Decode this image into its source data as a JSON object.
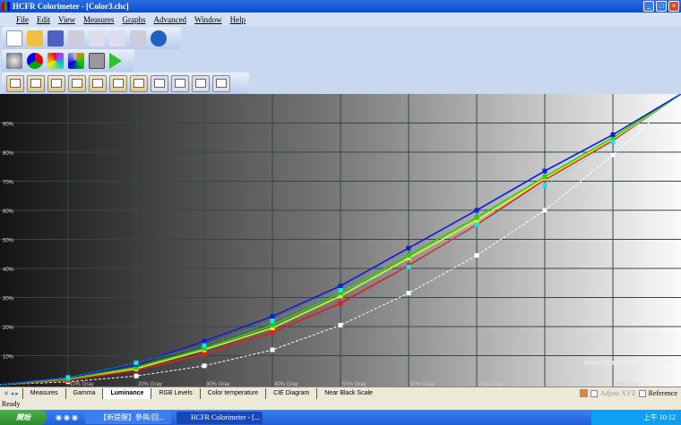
{
  "window": {
    "title": "HCFR Colorimeter - [Color3.chc]"
  },
  "menu": [
    "File",
    "Edit",
    "View",
    "Measures",
    "Graphs",
    "Advanced",
    "Window",
    "Help"
  ],
  "toolbar1": [
    "new-icon",
    "open-icon",
    "save-icon",
    "cut-icon",
    "copy-icon",
    "paste-icon",
    "print-icon",
    "help-icon"
  ],
  "toolbar2": [
    "gray-measure-icon",
    "rgb-measure-icon",
    "saturation-measure-icon",
    "all-colors-icon",
    "camera-icon",
    "play-icon"
  ],
  "toolbar3_count": 11,
  "tabs": [
    "Measures",
    "Gamma",
    "Luminance",
    "RGB Levels",
    "Color temperature",
    "CIE Diagram",
    "Near Black Scale"
  ],
  "active_tab": "Luminance",
  "options": {
    "adjust_label": "Adjust XYZ",
    "reference_label": "Reference"
  },
  "status": "Ready",
  "watermark": "www.homecinema-fr.com",
  "taskbar": {
    "start": "開始",
    "tasks": [
      "【新提醒】參與/回...",
      "HCFR Colorimeter - [..."
    ],
    "clock": "上午 10:12"
  },
  "chart_data": {
    "type": "line",
    "x": [
      0,
      10,
      20,
      30,
      40,
      50,
      60,
      70,
      80,
      90,
      100
    ],
    "x_tick_labels": [
      "",
      "10% Gray",
      "20% Gray",
      "30% Gray",
      "40% Gray",
      "50% Gray",
      "60% Gray",
      "70% Gray",
      "80% Gray",
      "90% Gray",
      ""
    ],
    "y_tick_labels": [
      "10%",
      "20%",
      "30%",
      "40%",
      "50%",
      "60%",
      "70%",
      "80%",
      "90%"
    ],
    "ylim": [
      0,
      100
    ],
    "grid": true,
    "series": [
      {
        "color": "#ffffff",
        "dashed": true,
        "values": [
          0,
          1,
          3,
          6.5,
          12,
          20.5,
          31.5,
          44.5,
          60,
          79,
          100
        ]
      },
      {
        "color": "#e02020",
        "values": [
          0,
          1.5,
          5,
          10.5,
          18,
          28,
          41,
          55,
          70.5,
          84,
          100
        ]
      },
      {
        "color": "#e8f020",
        "values": [
          0,
          2,
          5.5,
          12,
          19.5,
          30.5,
          43.5,
          56.5,
          71,
          84.5,
          100
        ]
      },
      {
        "color": "#20d020",
        "values": [
          0,
          2,
          6,
          12.5,
          20.5,
          31.5,
          44.5,
          57.5,
          71.5,
          85,
          100
        ]
      },
      {
        "color": "#1020d0",
        "values": [
          0,
          2.5,
          7,
          15,
          23.5,
          34,
          47,
          60,
          73.5,
          86,
          100
        ]
      },
      {
        "color": "#20e0e8",
        "dotted": true,
        "values": [
          0,
          2.5,
          7.5,
          13.5,
          22,
          32.5,
          40.5,
          55,
          68.5,
          83.5,
          100
        ]
      }
    ]
  }
}
